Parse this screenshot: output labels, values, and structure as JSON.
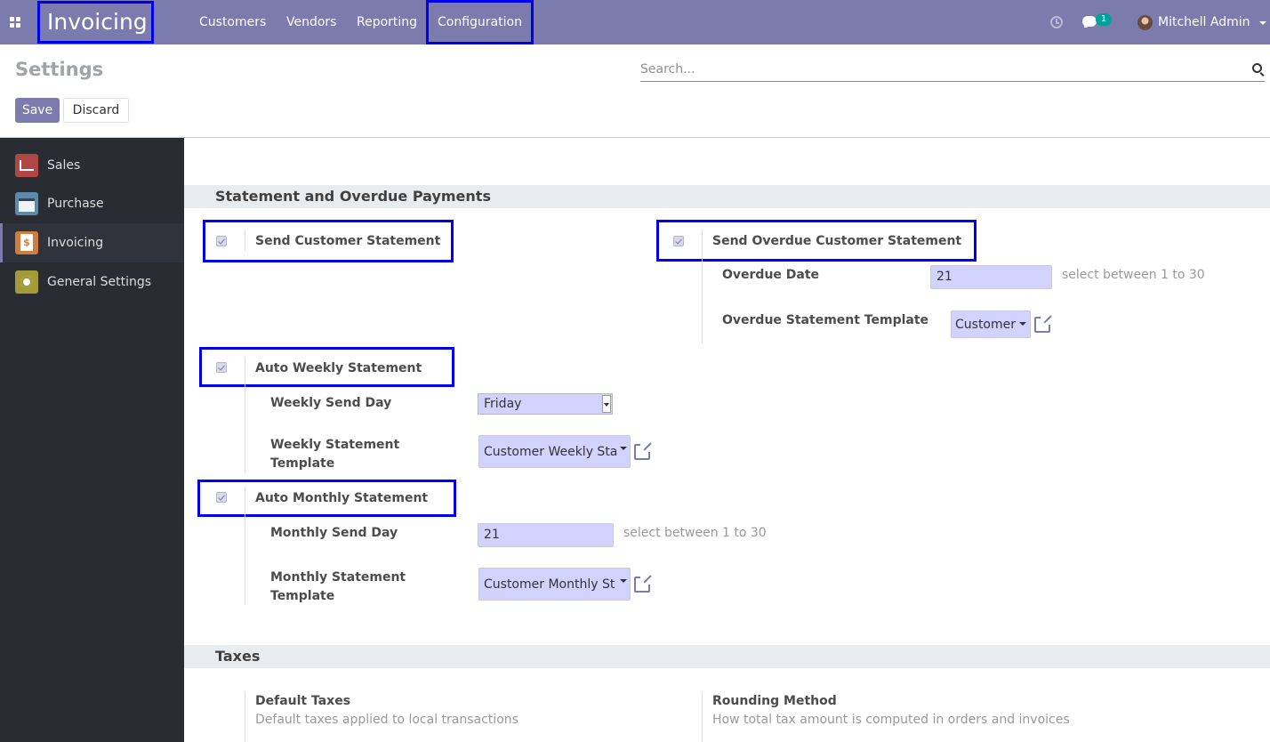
{
  "navbar": {
    "brand": "Invoicing",
    "menu": [
      "Customers",
      "Vendors",
      "Reporting",
      "Configuration"
    ],
    "chat_count": "1",
    "user": "Mitchell Admin",
    "icons": [
      "apps-icon",
      "clock-icon",
      "chat-icon",
      "avatar"
    ]
  },
  "control_panel": {
    "title": "Settings",
    "search_placeholder": "Search...",
    "save_label": "Save",
    "discard_label": "Discard"
  },
  "sidebar": {
    "items": [
      {
        "label": "Sales",
        "icon": "sales-icon"
      },
      {
        "label": "Purchase",
        "icon": "purchase-icon"
      },
      {
        "label": "Invoicing",
        "icon": "invoicing-icon",
        "active": true
      },
      {
        "label": "General Settings",
        "icon": "general-settings-icon"
      }
    ]
  },
  "statement_section": {
    "title": "Statement and Overdue Payments",
    "send_customer_statement": "Send Customer Statement",
    "send_overdue": {
      "label": "Send Overdue Customer Statement",
      "overdue_date_label": "Overdue Date",
      "overdue_date_value": "21",
      "overdue_date_hint": "select between 1 to 30",
      "template_label": "Overdue Statement Template",
      "template_value": "Customer"
    },
    "weekly": {
      "label": "Auto Weekly Statement",
      "send_day_label": "Weekly Send Day",
      "send_day_value": "Friday",
      "template_label_1": "Weekly Statement",
      "template_label_2": "Template",
      "template_value": "Customer Weekly Sta"
    },
    "monthly": {
      "label": "Auto Monthly Statement",
      "send_day_label": "Monthly Send Day",
      "send_day_value": "21",
      "send_day_hint": "select between 1 to 30",
      "template_label_1": "Monthly Statement",
      "template_label_2": "Template",
      "template_value": "Customer Monthly St"
    }
  },
  "taxes_section": {
    "title": "Taxes",
    "default_taxes": {
      "label": "Default Taxes",
      "desc": "Default taxes applied to local transactions"
    },
    "rounding": {
      "label": "Rounding Method",
      "desc": "How total tax amount is computed in orders and invoices"
    }
  },
  "colors": {
    "navbar": "#7c7bad",
    "sidebar": "#292c33",
    "highlight": "#0000ee",
    "input_bg": "#d2d2ff"
  }
}
